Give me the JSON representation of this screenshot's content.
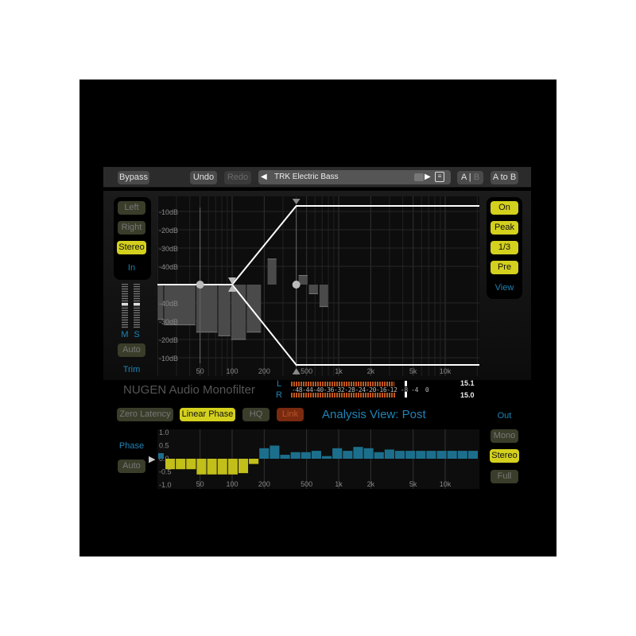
{
  "colors": {
    "accent_yellow": "#d4d01e",
    "blue_text": "#1f84b6",
    "phase_positive": "#1c6f8c",
    "phase_negative": "#c2be1a",
    "meter": "#c0581e",
    "link_active": "#7a2a0e"
  },
  "toolbar": {
    "bypass": "Bypass",
    "undo": "Undo",
    "redo": "Redo",
    "preset_name": "TRK Electric Bass",
    "prev_icon": "triangle-left",
    "next_icon": "triangle-right",
    "menu_icon": "list-menu",
    "ab_a": "A",
    "ab_sep": "|",
    "ab_b": "B",
    "a_to_b": "A to B"
  },
  "input_panel": {
    "left": "Left",
    "right": "Right",
    "stereo": "Stereo",
    "label": "In",
    "selected": "Stereo"
  },
  "trim": {
    "m": "M",
    "s": "S",
    "auto": "Auto",
    "label": "Trim"
  },
  "view_panel": {
    "on": "On",
    "peak": "Peak",
    "third": "1/3",
    "pre": "Pre",
    "label": "View"
  },
  "eq_graph": {
    "db_labels_upper": [
      "-10dB",
      "-20dB",
      "-30dB",
      "-40dB"
    ],
    "db_labels_lower": [
      "-40dB",
      "-30dB",
      "-20dB",
      "-10dB"
    ],
    "freq_labels": [
      {
        "f": 50,
        "t": "50"
      },
      {
        "f": 100,
        "t": "100"
      },
      {
        "f": 200,
        "t": "200"
      },
      {
        "f": 500,
        "t": "500"
      },
      {
        "f": 1000,
        "t": "1k"
      },
      {
        "f": 2000,
        "t": "2k"
      },
      {
        "f": 5000,
        "t": "5k"
      },
      {
        "f": 10000,
        "t": "10k"
      }
    ],
    "filter": {
      "crossover_hz": 100,
      "transition_end_hz": 400,
      "marker_hz": 50
    },
    "analyzer_bands": [
      {
        "lo": 20,
        "hi": 23,
        "db": -31,
        "side": "down"
      },
      {
        "lo": 23,
        "hi": 46,
        "db": -28,
        "side": "down"
      },
      {
        "lo": 46,
        "hi": 74,
        "db": -24,
        "side": "down"
      },
      {
        "lo": 74,
        "hi": 98,
        "db": -22,
        "side": "down"
      },
      {
        "lo": 98,
        "hi": 137,
        "db": -20,
        "side": "down"
      },
      {
        "lo": 137,
        "hi": 190,
        "db": -24,
        "side": "down"
      },
      {
        "lo": 215,
        "hi": 265,
        "db": -36,
        "side": "up"
      },
      {
        "lo": 420,
        "hi": 520,
        "db": -45,
        "side": "up"
      },
      {
        "lo": 525,
        "hi": 650,
        "db": -45,
        "side": "down"
      },
      {
        "lo": 660,
        "hi": 810,
        "db": -38,
        "side": "down"
      }
    ]
  },
  "branding": {
    "title": "NUGEN Audio Monofilter"
  },
  "meter": {
    "l": "L",
    "r": "R",
    "scale": "-48-44-40-36-32-28-24-20-16-12 -8 -4  0",
    "l_value": "15.1",
    "r_value": "15.0",
    "l_level": 0.59,
    "r_level": 0.6
  },
  "options": {
    "zero_latency": "Zero Latency",
    "linear_phase": "Linear Phase",
    "hq": "HQ",
    "link": "Link",
    "analysis_view": "Analysis View: Post"
  },
  "output": {
    "label": "Out",
    "mono": "Mono",
    "stereo": "Stereo",
    "full": "Full",
    "selected": "Stereo"
  },
  "phase": {
    "label": "Phase",
    "auto": "Auto",
    "y_labels": [
      "1.0",
      "0.5",
      "0.0",
      "-0.5",
      "-1.0"
    ],
    "freq_labels": [
      {
        "f": 50,
        "t": "50"
      },
      {
        "f": 100,
        "t": "100"
      },
      {
        "f": 200,
        "t": "200"
      },
      {
        "f": 500,
        "t": "500"
      },
      {
        "f": 1000,
        "t": "1k"
      },
      {
        "f": 2000,
        "t": "2k"
      },
      {
        "f": 5000,
        "t": "5k"
      },
      {
        "f": 10000,
        "t": "10k"
      }
    ],
    "bands": [
      -0.4,
      -0.4,
      -0.4,
      -0.6,
      -0.6,
      -0.6,
      -0.6,
      -0.55,
      -0.2,
      0.4,
      0.5,
      0.15,
      0.25,
      0.25,
      0.3,
      0.1,
      0.4,
      0.3,
      0.45,
      0.4,
      0.25,
      0.35,
      0.3,
      0.3,
      0.3,
      0.3,
      0.3,
      0.3,
      0.3,
      0.3
    ]
  }
}
